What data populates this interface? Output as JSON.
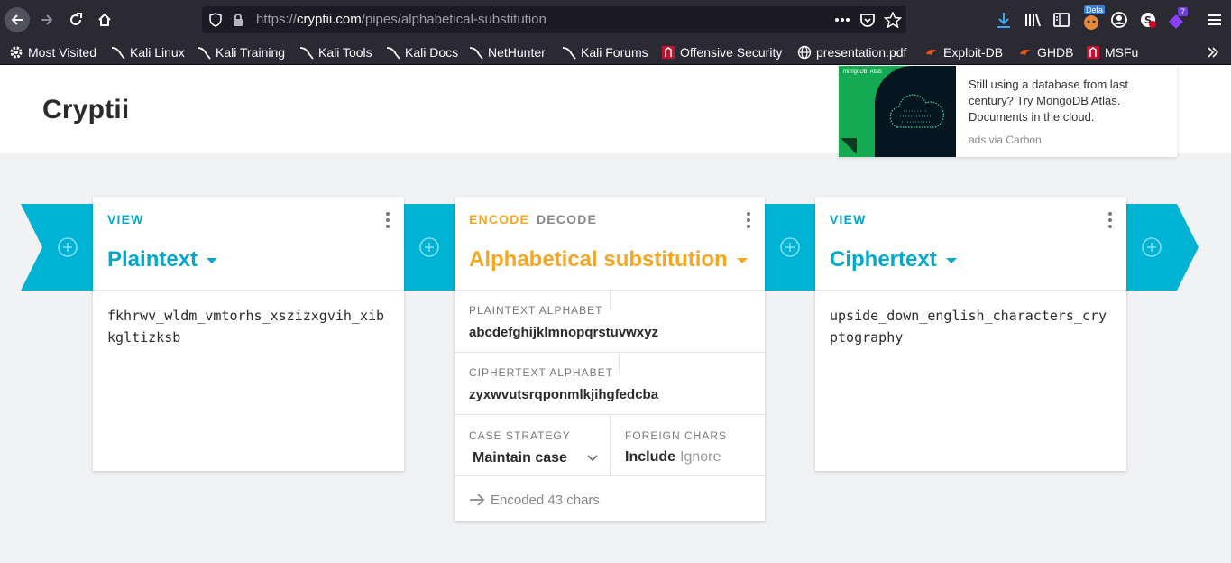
{
  "browser": {
    "url_prefix": "https://",
    "url_host": "cryptii.com",
    "url_path": "/pipes/alphabetical-substitution",
    "download_badge": "Defa",
    "ext_badge": "7",
    "bookmarks": [
      {
        "label": "Most Visited",
        "icon": "gear-icon"
      },
      {
        "label": "Kali Linux",
        "icon": "kali-dragon-icon"
      },
      {
        "label": "Kali Training",
        "icon": "kali-dragon-icon"
      },
      {
        "label": "Kali Tools",
        "icon": "kali-dragon-icon"
      },
      {
        "label": "Kali Docs",
        "icon": "kali-dragon-icon"
      },
      {
        "label": "NetHunter",
        "icon": "kali-dragon-icon"
      },
      {
        "label": "Kali Forums",
        "icon": "kali-dragon-icon"
      },
      {
        "label": "Offensive Security",
        "icon": "offsec-icon"
      },
      {
        "label": "presentation.pdf",
        "icon": "globe-icon"
      },
      {
        "label": "Exploit-DB",
        "icon": "exploitdb-icon"
      },
      {
        "label": "GHDB",
        "icon": "exploitdb-icon"
      },
      {
        "label": "MSFu",
        "icon": "offsec-icon"
      }
    ]
  },
  "header": {
    "logo": "Cryptii"
  },
  "ad": {
    "brand": "mongoDB. Atlas",
    "text": "Still using a database from last century? Try MongoDB Atlas. Documents in the cloud.",
    "via": "ads via Carbon"
  },
  "bricks": {
    "plaintext": {
      "tag": "VIEW",
      "title": "Plaintext",
      "content": "fkhrwv_wldm_vmtorhs_xszizxgvih_xibkgltizksb"
    },
    "substitution": {
      "tab_encode": "ENCODE",
      "tab_decode": "DECODE",
      "title": "Alphabetical substitution",
      "plaintext_alphabet_label": "PLAINTEXT ALPHABET",
      "plaintext_alphabet": "abcdefghijklmnopqrstuvwxyz",
      "ciphertext_alphabet_label": "CIPHERTEXT ALPHABET",
      "ciphertext_alphabet": "zyxwvutsrqponmlkjihgfedcba",
      "case_strategy_label": "CASE STRATEGY",
      "case_strategy": "Maintain case",
      "foreign_chars_label": "FOREIGN CHARS",
      "foreign_include": "Include",
      "foreign_ignore": "Ignore",
      "status": "Encoded 43 chars"
    },
    "ciphertext": {
      "tag": "VIEW",
      "title": "Ciphertext",
      "content": "upside_down_english_characters_cryptography"
    }
  },
  "colors": {
    "accent_cyan": "#00a9c9",
    "accent_orange": "#f5a623",
    "pipe": "#00b3d4"
  }
}
